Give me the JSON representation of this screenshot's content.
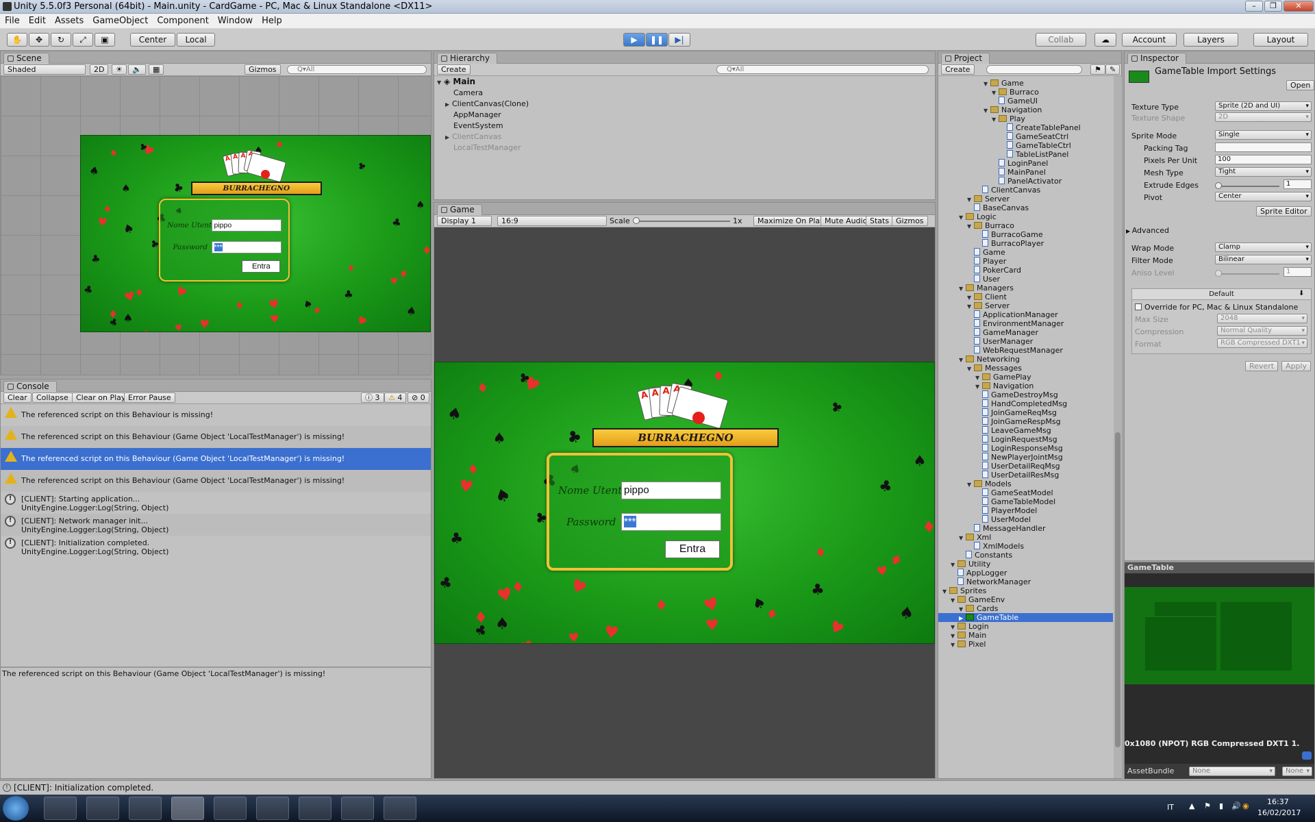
{
  "window": {
    "title": "Unity 5.5.0f3 Personal (64bit) - Main.unity - CardGame - PC, Mac & Linux Standalone <DX11>"
  },
  "menu": [
    "File",
    "Edit",
    "Assets",
    "GameObject",
    "Component",
    "Window",
    "Help"
  ],
  "toolbar": {
    "center": "Center",
    "local": "Local",
    "collab": "Collab",
    "account": "Account",
    "layers": "Layers",
    "layout": "Layout"
  },
  "scene": {
    "tab": "Scene",
    "shading": "Shaded",
    "mode2d": "2D",
    "gizmos": "Gizmos",
    "search": "Q▾All"
  },
  "hierarchy": {
    "tab": "Hierarchy",
    "create": "Create",
    "search": "Q▾All",
    "root": "Main",
    "items": [
      "Camera",
      "ClientCanvas(Clone)",
      "AppManager",
      "EventSystem",
      "ClientCanvas",
      "LocalTestManager"
    ]
  },
  "game": {
    "tab": "Game",
    "display": "Display 1",
    "aspect": "16:9",
    "scale_label": "Scale",
    "scale_value": "1x",
    "maximize": "Maximize On Play",
    "mute": "Mute Audio",
    "stats": "Stats",
    "gizmos": "Gizmos",
    "title": "BURRACHEGNO",
    "user_label": "Nome Utente",
    "user_value": "pippo",
    "pass_label": "Password",
    "pass_value": "***",
    "enter": "Entra"
  },
  "console": {
    "tab": "Console",
    "clear": "Clear",
    "collapse": "Collapse",
    "clear_on_play": "Clear on Play",
    "error_pause": "Error Pause",
    "count_info": "3",
    "count_warn": "4",
    "count_err": "0",
    "entries": [
      {
        "type": "warn",
        "text": "The referenced script on this Behaviour is missing!"
      },
      {
        "type": "warn",
        "text": "The referenced script on this Behaviour (Game Object 'LocalTestManager') is missing!"
      },
      {
        "type": "warn",
        "text": "The referenced script on this Behaviour (Game Object 'LocalTestManager') is missing!"
      },
      {
        "type": "warn",
        "text": "The referenced script on this Behaviour (Game Object 'LocalTestManager') is missing!"
      },
      {
        "type": "info",
        "text": "[CLIENT]: Starting application...",
        "sub": "UnityEngine.Logger:Log(String, Object)"
      },
      {
        "type": "info",
        "text": "[CLIENT]: Network manager init...",
        "sub": "UnityEngine.Logger:Log(String, Object)"
      },
      {
        "type": "info",
        "text": "[CLIENT]: Initialization completed.",
        "sub": "UnityEngine.Logger:Log(String, Object)"
      }
    ],
    "detail": "The referenced script on this Behaviour (Game Object 'LocalTestManager') is missing!"
  },
  "status": {
    "text": "[CLIENT]: Initialization completed."
  },
  "project": {
    "tab": "Project",
    "create": "Create",
    "tree": [
      {
        "d": 4,
        "t": "Game",
        "f": 1
      },
      {
        "d": 5,
        "t": "Burraco",
        "f": 1
      },
      {
        "d": 5,
        "t": "GameUI",
        "f": 0
      },
      {
        "d": 4,
        "t": "Navigation",
        "f": 1
      },
      {
        "d": 5,
        "t": "Play",
        "f": 1
      },
      {
        "d": 6,
        "t": "CreateTablePanel",
        "f": 0
      },
      {
        "d": 6,
        "t": "GameSeatCtrl",
        "f": 0
      },
      {
        "d": 6,
        "t": "GameTableCtrl",
        "f": 0
      },
      {
        "d": 6,
        "t": "TableListPanel",
        "f": 0
      },
      {
        "d": 5,
        "t": "LoginPanel",
        "f": 0
      },
      {
        "d": 5,
        "t": "MainPanel",
        "f": 0
      },
      {
        "d": 5,
        "t": "PanelActivator",
        "f": 0
      },
      {
        "d": 3,
        "t": "ClientCanvas",
        "f": 0
      },
      {
        "d": 2,
        "t": "Server",
        "f": 1
      },
      {
        "d": 2,
        "t": "BaseCanvas",
        "f": 0
      },
      {
        "d": 1,
        "t": "Logic",
        "f": 1
      },
      {
        "d": 2,
        "t": "Burraco",
        "f": 1
      },
      {
        "d": 3,
        "t": "BurracoGame",
        "f": 0
      },
      {
        "d": 3,
        "t": "BurracoPlayer",
        "f": 0
      },
      {
        "d": 2,
        "t": "Game",
        "f": 0
      },
      {
        "d": 2,
        "t": "Player",
        "f": 0
      },
      {
        "d": 2,
        "t": "PokerCard",
        "f": 0
      },
      {
        "d": 2,
        "t": "User",
        "f": 0
      },
      {
        "d": 1,
        "t": "Managers",
        "f": 1
      },
      {
        "d": 2,
        "t": "Client",
        "f": 1
      },
      {
        "d": 2,
        "t": "Server",
        "f": 1
      },
      {
        "d": 2,
        "t": "ApplicationManager",
        "f": 0
      },
      {
        "d": 2,
        "t": "EnvironmentManager",
        "f": 0
      },
      {
        "d": 2,
        "t": "GameManager",
        "f": 0
      },
      {
        "d": 2,
        "t": "UserManager",
        "f": 0
      },
      {
        "d": 2,
        "t": "WebRequestManager",
        "f": 0
      },
      {
        "d": 1,
        "t": "Networking",
        "f": 1
      },
      {
        "d": 2,
        "t": "Messages",
        "f": 1
      },
      {
        "d": 3,
        "t": "GamePlay",
        "f": 1
      },
      {
        "d": 3,
        "t": "Navigation",
        "f": 1
      },
      {
        "d": 3,
        "t": "GameDestroyMsg",
        "f": 0
      },
      {
        "d": 3,
        "t": "HandCompletedMsg",
        "f": 0
      },
      {
        "d": 3,
        "t": "JoinGameReqMsg",
        "f": 0
      },
      {
        "d": 3,
        "t": "JoinGameRespMsg",
        "f": 0
      },
      {
        "d": 3,
        "t": "LeaveGameMsg",
        "f": 0
      },
      {
        "d": 3,
        "t": "LoginRequestMsg",
        "f": 0
      },
      {
        "d": 3,
        "t": "LoginResponseMsg",
        "f": 0
      },
      {
        "d": 3,
        "t": "NewPlayerJointMsg",
        "f": 0
      },
      {
        "d": 3,
        "t": "UserDetailReqMsg",
        "f": 0
      },
      {
        "d": 3,
        "t": "UserDetailResMsg",
        "f": 0
      },
      {
        "d": 2,
        "t": "Models",
        "f": 1
      },
      {
        "d": 3,
        "t": "GameSeatModel",
        "f": 0
      },
      {
        "d": 3,
        "t": "GameTableModel",
        "f": 0
      },
      {
        "d": 3,
        "t": "PlayerModel",
        "f": 0
      },
      {
        "d": 3,
        "t": "UserModel",
        "f": 0
      },
      {
        "d": 2,
        "t": "MessageHandler",
        "f": 0
      },
      {
        "d": 1,
        "t": "Xml",
        "f": 1
      },
      {
        "d": 2,
        "t": "XmlModels",
        "f": 0
      },
      {
        "d": 1,
        "t": "Constants",
        "f": 0
      },
      {
        "d": 0,
        "t": "Utility",
        "f": 1
      },
      {
        "d": 0,
        "t": "AppLogger",
        "f": 0
      },
      {
        "d": 0,
        "t": "NetworkManager",
        "f": 0
      },
      {
        "d": -1,
        "t": "Sprites",
        "f": 1
      },
      {
        "d": 0,
        "t": "GameEnv",
        "f": 1
      },
      {
        "d": 1,
        "t": "Cards",
        "f": 1
      },
      {
        "d": 1,
        "t": "GameTable",
        "f": 2
      },
      {
        "d": 0,
        "t": "Login",
        "f": 1
      },
      {
        "d": 0,
        "t": "Main",
        "f": 1
      },
      {
        "d": 0,
        "t": "Pixel",
        "f": 1
      }
    ]
  },
  "inspector": {
    "tab": "Inspector",
    "title": "GameTable Import Settings",
    "open": "Open",
    "texture_type_label": "Texture Type",
    "texture_type": "Sprite (2D and UI)",
    "texture_shape_label": "Texture Shape",
    "texture_shape": "2D",
    "sprite_mode_label": "Sprite Mode",
    "sprite_mode": "Single",
    "packing_tag_label": "Packing Tag",
    "packing_tag": "",
    "ppu_label": "Pixels Per Unit",
    "ppu": "100",
    "mesh_type_label": "Mesh Type",
    "mesh_type": "Tight",
    "extrude_label": "Extrude Edges",
    "extrude": "1",
    "pivot_label": "Pivot",
    "pivot": "Center",
    "sprite_editor": "Sprite Editor",
    "advanced": "Advanced",
    "wrap_label": "Wrap Mode",
    "wrap": "Clamp",
    "filter_label": "Filter Mode",
    "filter": "Bilinear",
    "aniso_label": "Aniso Level",
    "aniso": "1",
    "default_tab": "Default",
    "override": "Override for PC, Mac & Linux Standalone",
    "max_size_label": "Max Size",
    "max_size": "2048",
    "compression_label": "Compression",
    "compression": "Normal Quality",
    "format_label": "Format",
    "format": "RGB Compressed DXT1",
    "revert": "Revert",
    "apply": "Apply",
    "preview_title": "GameTable",
    "preview_info": "0x1080 (NPOT)  RGB Compressed DXT1   1.",
    "assetbundle_label": "AssetBundle",
    "assetbundle": "None",
    "assetbundle_variant": "None"
  },
  "taskbar": {
    "lang": "IT",
    "time": "16:37",
    "date": "16/02/2017"
  },
  "colors": {
    "felt": "#1b9a18",
    "accent": "#3b78c8",
    "gold": "#f0c236",
    "selection": "#3b6fd0"
  }
}
